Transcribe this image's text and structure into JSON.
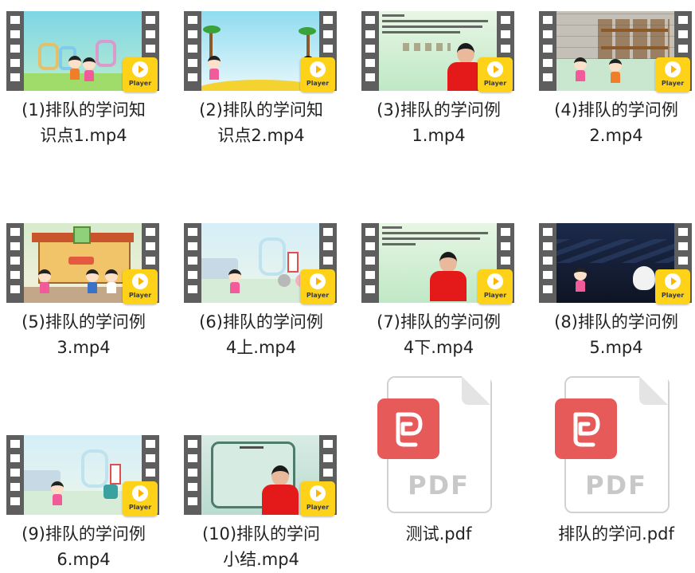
{
  "files": [
    {
      "name": "(1)排队的学问知识点1.mp4",
      "line1": "(1)排队的学问知",
      "line2": "识点1.mp4",
      "type": "video",
      "badge": "Player"
    },
    {
      "name": "(2)排队的学问知识点2.mp4",
      "line1": "(2)排队的学问知",
      "line2": "识点2.mp4",
      "type": "video",
      "badge": "Player"
    },
    {
      "name": "(3)排队的学问例1.mp4",
      "line1": "(3)排队的学问例",
      "line2": "1.mp4",
      "type": "video",
      "badge": "Player"
    },
    {
      "name": "(4)排队的学问例2.mp4",
      "line1": "(4)排队的学问例",
      "line2": "2.mp4",
      "type": "video",
      "badge": "Player"
    },
    {
      "name": "(5)排队的学问例3.mp4",
      "line1": "(5)排队的学问例",
      "line2": "3.mp4",
      "type": "video",
      "badge": "Player"
    },
    {
      "name": "(6)排队的学问例4上.mp4",
      "line1": "(6)排队的学问例",
      "line2": "4上.mp4",
      "type": "video",
      "badge": "Player"
    },
    {
      "name": "(7)排队的学问例4下.mp4",
      "line1": "(7)排队的学问例",
      "line2": "4下.mp4",
      "type": "video",
      "badge": "Player"
    },
    {
      "name": "(8)排队的学问例5.mp4",
      "line1": "(8)排队的学问例",
      "line2": "5.mp4",
      "type": "video",
      "badge": "Player"
    },
    {
      "name": "(9)排队的学问例6.mp4",
      "line1": "(9)排队的学问例",
      "line2": "6.mp4",
      "type": "video",
      "badge": "Player"
    },
    {
      "name": "(10)排队的学问小结.mp4",
      "line1": "(10)排队的学问",
      "line2": "小结.mp4",
      "type": "video",
      "badge": "Player"
    },
    {
      "name": "测试.pdf",
      "line1": "测试.pdf",
      "line2": "",
      "type": "pdf",
      "icon_text": "PDF"
    },
    {
      "name": "排队的学问.pdf",
      "line1": "排队的学问.pdf",
      "line2": "",
      "type": "pdf",
      "icon_text": "PDF"
    }
  ],
  "colors": {
    "film_strip": "#5e5e5e",
    "badge": "#ffd21a",
    "pdf_logo": "#e75a5a",
    "pdf_text": "#c8c8c8"
  },
  "icons": {
    "video": "film-strip-thumbnail",
    "badge": "play-icon",
    "pdf": "pdf-document-icon"
  }
}
